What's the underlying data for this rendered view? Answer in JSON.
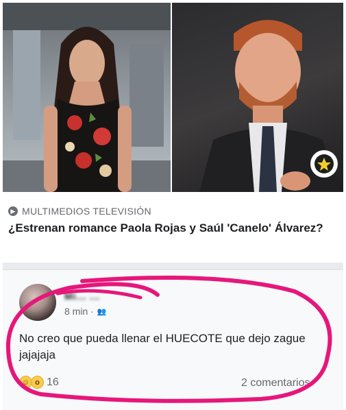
{
  "article": {
    "source_label": "MULTIMEDIOS TELEVISIÓN",
    "headline": "¿Estrenan romance Paola Rojas y Saúl 'Canelo' Álvarez?"
  },
  "comment": {
    "author_name": "Mi... ...",
    "timestamp": "8 min ·",
    "text": "No creo que pueda llenar el HUECOTE que dejo zague jajajaja",
    "reactions_count": "16",
    "comments_count": "2 comentarios",
    "reaction_icons": [
      "laugh-emoji-icon",
      "wow-emoji-icon"
    ]
  },
  "colors": {
    "annotation_circle": "#e6177b",
    "text_primary": "#1c1e21",
    "text_secondary": "#65676b"
  }
}
